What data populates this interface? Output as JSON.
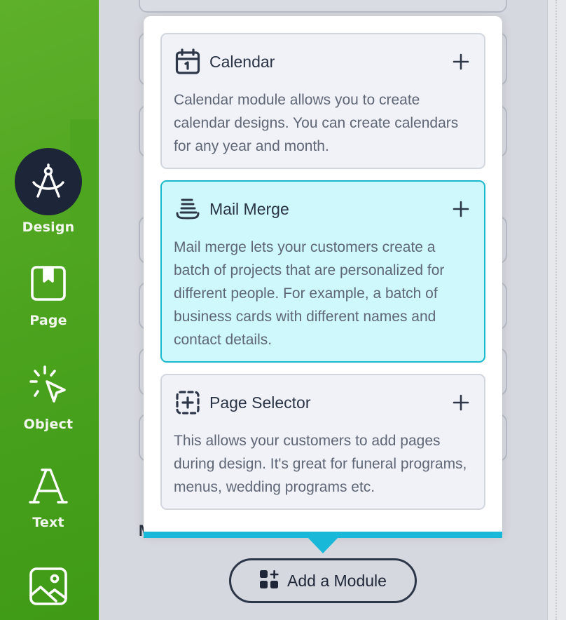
{
  "sidebar": {
    "items": [
      {
        "label": "Design",
        "icon": "compass-drafting-icon",
        "active": true
      },
      {
        "label": "Page",
        "icon": "bookmark-page-icon"
      },
      {
        "label": "Object",
        "icon": "pointer-click-icon"
      },
      {
        "label": "Text",
        "icon": "letter-a-icon"
      },
      {
        "label": "",
        "icon": "image-icon"
      }
    ],
    "accent": "#4aa21d",
    "active_bg": "#1d2538"
  },
  "modules": {
    "items": [
      {
        "title": "Calendar",
        "icon": "calendar-icon",
        "description": "Calendar module allows you to create calendar designs. You can create calendars for any year and month."
      },
      {
        "title": "Mail Merge",
        "icon": "stacked-layers-icon",
        "description": "Mail merge lets your customers create a batch of projects that are personalized for different people. For example, a batch of business cards with different names and contact details.",
        "highlighted": true
      },
      {
        "title": "Page Selector",
        "icon": "dashed-square-plus-icon",
        "description": "This allows your customers to add pages during design. It's great for funeral programs, menus, wedding programs etc."
      }
    ],
    "highlight_color": "#cef8fc",
    "accent_bar": "#19b8d8"
  },
  "add_module": {
    "label": "Add a Module",
    "icon": "apps-add-icon"
  },
  "background": {
    "partial_letter": "M"
  }
}
